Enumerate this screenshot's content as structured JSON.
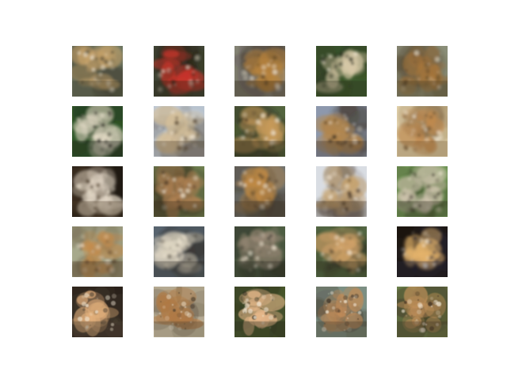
{
  "figure": {
    "rows": 5,
    "cols": 5,
    "tiles": [
      {
        "row": 0,
        "col": 0,
        "bg": "#6b7561",
        "accent": "#c9a36a",
        "dark": "#3c3a2b"
      },
      {
        "row": 0,
        "col": 1,
        "bg": "#3f4434",
        "accent": "#c9352b",
        "dark": "#2a2317"
      },
      {
        "row": 0,
        "col": 2,
        "bg": "#8f8e85",
        "accent": "#b8843d",
        "dark": "#2d2418"
      },
      {
        "row": 0,
        "col": 3,
        "bg": "#3d5a2d",
        "accent": "#d8c9a7",
        "dark": "#2a2f1f"
      },
      {
        "row": 0,
        "col": 4,
        "bg": "#8a8e78",
        "accent": "#a7763b",
        "dark": "#4d3d24"
      },
      {
        "row": 1,
        "col": 0,
        "bg": "#2f5a2a",
        "accent": "#e8dfca",
        "dark": "#22231a"
      },
      {
        "row": 1,
        "col": 1,
        "bg": "#c9d6e6",
        "accent": "#d8c29c",
        "dark": "#4b3b26"
      },
      {
        "row": 1,
        "col": 2,
        "bg": "#53643e",
        "accent": "#c89b5a",
        "dark": "#2a2419"
      },
      {
        "row": 1,
        "col": 3,
        "bg": "#8d98ad",
        "accent": "#b5874b",
        "dark": "#3a2e21"
      },
      {
        "row": 1,
        "col": 4,
        "bg": "#e3d3ad",
        "accent": "#c28a4e",
        "dark": "#6f5533"
      },
      {
        "row": 2,
        "col": 0,
        "bg": "#1f1912",
        "accent": "#eee3d2",
        "dark": "#4b3b28"
      },
      {
        "row": 2,
        "col": 1,
        "bg": "#6e7f50",
        "accent": "#b08253",
        "dark": "#3b2d1f"
      },
      {
        "row": 2,
        "col": 2,
        "bg": "#6f7270",
        "accent": "#c18a43",
        "dark": "#3e3324"
      },
      {
        "row": 2,
        "col": 3,
        "bg": "#d9dde3",
        "accent": "#c6a06b",
        "dark": "#403124"
      },
      {
        "row": 2,
        "col": 4,
        "bg": "#77a35a",
        "accent": "#d2c7b1",
        "dark": "#2f2a1f"
      },
      {
        "row": 3,
        "col": 0,
        "bg": "#a7a98c",
        "accent": "#c58b4a",
        "dark": "#4f3a25"
      },
      {
        "row": 3,
        "col": 1,
        "bg": "#58646f",
        "accent": "#e2d9c5",
        "dark": "#2f2a21"
      },
      {
        "row": 3,
        "col": 2,
        "bg": "#4d5d42",
        "accent": "#9b8b78",
        "dark": "#2a2a22"
      },
      {
        "row": 3,
        "col": 3,
        "bg": "#5c7a4c",
        "accent": "#d5a56a",
        "dark": "#2f291f"
      },
      {
        "row": 3,
        "col": 4,
        "bg": "#1b140e",
        "accent": "#e6b56c",
        "dark": "#2b2b3d"
      },
      {
        "row": 4,
        "col": 0,
        "bg": "#2a211a",
        "accent": "#e3b07c",
        "dark": "#4b4032"
      },
      {
        "row": 4,
        "col": 1,
        "bg": "#d8cdb3",
        "accent": "#b07a45",
        "dark": "#4b3f2f"
      },
      {
        "row": 4,
        "col": 2,
        "bg": "#4a5a2f",
        "accent": "#e7b88a",
        "dark": "#2b2a1d"
      },
      {
        "row": 4,
        "col": 3,
        "bg": "#7c8f83",
        "accent": "#c18b58",
        "dark": "#3f3427"
      },
      {
        "row": 4,
        "col": 4,
        "bg": "#6b7f4b",
        "accent": "#c0905a",
        "dark": "#3d2f20"
      }
    ]
  }
}
